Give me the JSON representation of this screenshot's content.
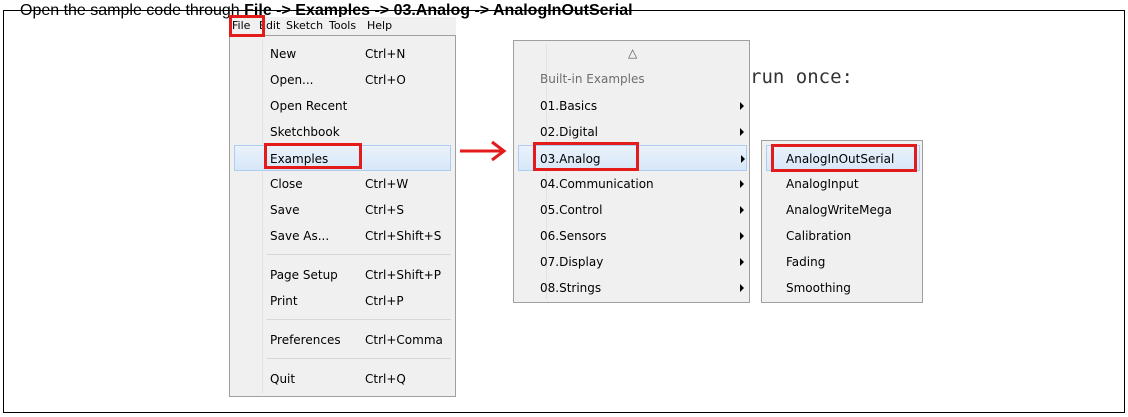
{
  "caption": {
    "prefix": "Open the sample code through ",
    "path_1": "File",
    "sep_1": " -> ",
    "path_2": "Examples",
    "sep_2": " -> ",
    "path_3": "03.Analog",
    "sep_3": " -> ",
    "path_4": "AnalogInOutSerial"
  },
  "menubar": [
    "File",
    "Edit",
    "Sketch",
    "Tools",
    "Help"
  ],
  "file_menu": [
    {
      "label": "New",
      "shortcut": "Ctrl+N"
    },
    {
      "label": "Open...",
      "shortcut": "Ctrl+O"
    },
    {
      "label": "Open Recent",
      "shortcut": ""
    },
    {
      "label": "Sketchbook",
      "shortcut": ""
    },
    {
      "label": "Examples",
      "shortcut": "",
      "highlighted": true
    },
    {
      "label": "Close",
      "shortcut": "Ctrl+W"
    },
    {
      "label": "Save",
      "shortcut": "Ctrl+S"
    },
    {
      "label": "Save As...",
      "shortcut": "Ctrl+Shift+S"
    },
    {
      "label": "Page Setup",
      "shortcut": "Ctrl+Shift+P"
    },
    {
      "label": "Print",
      "shortcut": "Ctrl+P"
    },
    {
      "label": "Preferences",
      "shortcut": "Ctrl+Comma"
    },
    {
      "label": "Quit",
      "shortcut": "Ctrl+Q"
    }
  ],
  "examples_menu": {
    "scroll_up": "△",
    "header": "Built-in Examples",
    "items": [
      "01.Basics",
      "02.Digital",
      "03.Analog",
      "04.Communication",
      "05.Control",
      "06.Sensors",
      "07.Display",
      "08.Strings"
    ],
    "selected": "03.Analog"
  },
  "analog_menu": {
    "items": [
      "AnalogInOutSerial",
      "AnalogInput",
      "AnalogWriteMega",
      "Calibration",
      "Fading",
      "Smoothing"
    ],
    "selected": "AnalogInOutSerial"
  },
  "code_fragment": "run once:",
  "colors": {
    "highlight_box": "#e31b1b",
    "menu_bg": "#f0f0f0",
    "hover_blue": "#d7e7f8"
  }
}
